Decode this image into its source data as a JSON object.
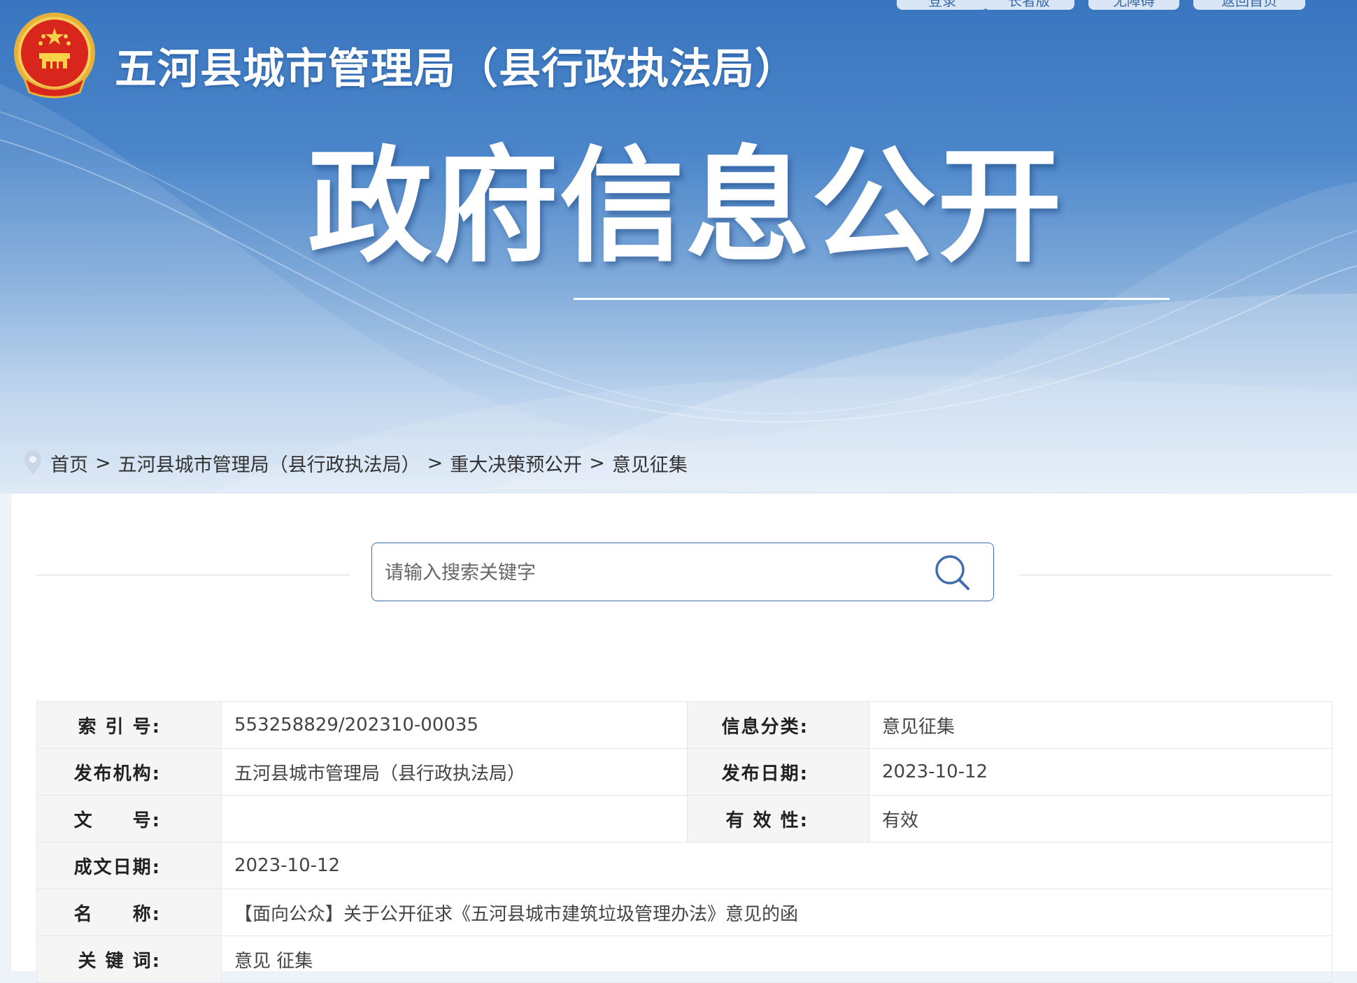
{
  "top_nav": [
    "登录",
    "长者版",
    "无障碍",
    "返回首页"
  ],
  "header": {
    "site_title": "五河县城市管理局（县行政执法局）",
    "hero_title": "政府信息公开"
  },
  "breadcrumb": {
    "items": [
      "首页",
      "五河县城市管理局（县行政执法局）",
      "重大决策预公开",
      "意见征集"
    ],
    "separator": ">"
  },
  "search": {
    "placeholder": "请输入搜索关键字",
    "value": ""
  },
  "info": {
    "index_label": "索 引 号:",
    "index_value": "553258829/202310-00035",
    "category_label": "信息分类:",
    "category_value": "意见征集",
    "publisher_label": "发布机构:",
    "publisher_value": "五河县城市管理局（县行政执法局）",
    "pubdate_label": "发布日期:",
    "pubdate_value": "2023-10-12",
    "docno_label": "文　　号:",
    "docno_value": "",
    "validity_label": "有 效 性:",
    "validity_value": "有效",
    "created_label": "成文日期:",
    "created_value": "2023-10-12",
    "name_label": "名　　称:",
    "name_value": "【面向公众】关于公开征求《五河县城市建筑垃圾管理办法》意见的函",
    "keywords_label": "关 键 词:",
    "keywords_value": "意见 征集"
  },
  "colors": {
    "banner_blue": "#3a76c0",
    "accent": "#3f6eae",
    "label_bg": "#f5f5f5"
  },
  "icons": [
    "national-emblem-icon",
    "location-pin-icon",
    "search-icon"
  ]
}
